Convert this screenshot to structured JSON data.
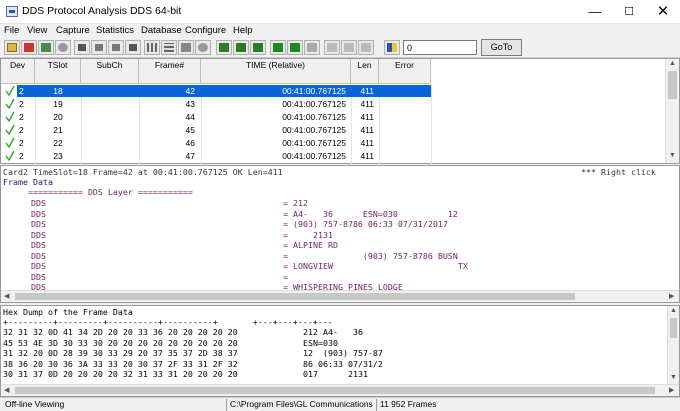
{
  "window": {
    "title": "DDS Protocol Analysis DDS 64-bit",
    "minimize": "—",
    "maximize": "☐",
    "close": "✕"
  },
  "menu": {
    "file": "File",
    "view": "View",
    "capture": "Capture",
    "statistics": "Statistics",
    "database": "Database",
    "configure": "Configure",
    "help": "Help"
  },
  "toolbar": {
    "frame_value": "0",
    "goto_label": "GoTo"
  },
  "table": {
    "columns": [
      "Dev",
      "TSlot",
      "SubCh",
      "Frame#",
      "TIME (Relative)",
      "Len",
      "Error"
    ],
    "rows": [
      {
        "dev": "2",
        "tslot": "18",
        "subch": "",
        "frame": "42",
        "time": "00:41:00.767125",
        "len": "411",
        "error": ""
      },
      {
        "dev": "2",
        "tslot": "19",
        "subch": "",
        "frame": "43",
        "time": "00:41:00.767125",
        "len": "411",
        "error": ""
      },
      {
        "dev": "2",
        "tslot": "20",
        "subch": "",
        "frame": "44",
        "time": "00:41:00.767125",
        "len": "411",
        "error": ""
      },
      {
        "dev": "2",
        "tslot": "21",
        "subch": "",
        "frame": "45",
        "time": "00:41:00.767125",
        "len": "411",
        "error": ""
      },
      {
        "dev": "2",
        "tslot": "22",
        "subch": "",
        "frame": "46",
        "time": "00:41:00.767125",
        "len": "411",
        "error": ""
      },
      {
        "dev": "2",
        "tslot": "23",
        "subch": "",
        "frame": "47",
        "time": "00:41:00.767125",
        "len": "411",
        "error": ""
      }
    ]
  },
  "decode": {
    "summary_left": "Card2 TimeSlot=18 Frame=42 at 00:41:00.767125 OK Len=411",
    "summary_right": "*** Right click",
    "frame_data_label": "Frame Data",
    "layer_header": "=========== DDS Layer ===========",
    "lines": [
      {
        "label": "DDS",
        "sep": "=",
        "value": "212"
      },
      {
        "label": "DDS",
        "sep": "=",
        "value": "A4-   36      ESN=030          12"
      },
      {
        "label": "DDS",
        "sep": "=",
        "value": "(903) 757-8786 06:33 07/31/2017"
      },
      {
        "label": "DDS",
        "sep": "=",
        "value": "    2131"
      },
      {
        "label": "DDS",
        "sep": "=",
        "value": "ALPINE RD"
      },
      {
        "label": "DDS",
        "sep": "=",
        "value": "              (903) 757-8786 BUSN"
      },
      {
        "label": "DDS",
        "sep": "=",
        "value": "LONGVIEW                         TX"
      },
      {
        "label": "DDS",
        "sep": "=",
        "value": ""
      },
      {
        "label": "DDS",
        "sep": "=",
        "value": "WHISPERING PINES LODGE"
      }
    ]
  },
  "hex": {
    "title": "Hex Dump of the Frame Data",
    "ruler": "+---------+---------+----------+----------+       +---+---+---+---",
    "lines": [
      {
        "hex": "32 31 32 0D 41 34 2D 20 20 33 36 20 20 20 20 20",
        "ascii": "212 A4-   36"
      },
      {
        "hex": "45 53 4E 3D 30 33 30 20 20 20 20 20 20 20 20 20",
        "ascii": "ESN=030"
      },
      {
        "hex": "31 32 20 0D 28 39 30 33 29 20 37 35 37 2D 38 37",
        "ascii": "12  (903) 757-87"
      },
      {
        "hex": "38 36 20 30 36 3A 33 33 20 30 37 2F 33 31 2F 32",
        "ascii": "86 06:33 07/31/2"
      },
      {
        "hex": "30 31 37 0D 20 20 20 20 32 31 33 31 20 20 20 20",
        "ascii": "017      2131"
      }
    ]
  },
  "status": {
    "mode": "Off-line Viewing",
    "path": "C:\\Program Files\\GL Communications",
    "frames": "11 952 Frames"
  }
}
